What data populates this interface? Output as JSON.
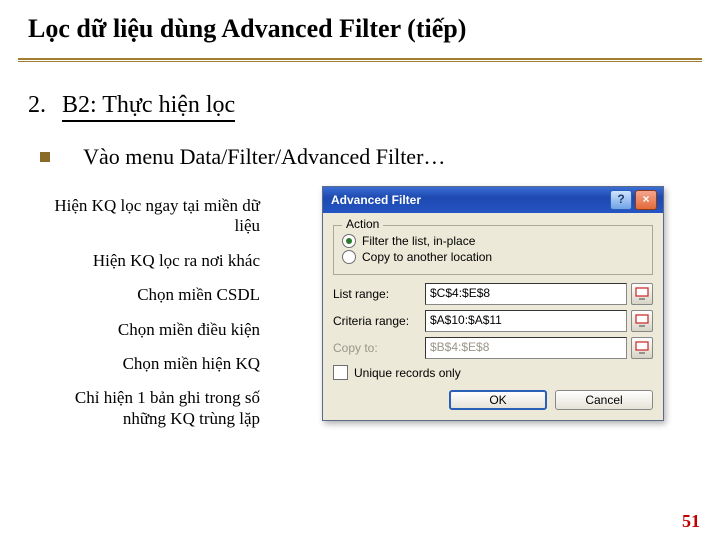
{
  "title": "Lọc dữ liệu dùng Advanced Filter (tiếp)",
  "step": {
    "num": "2.",
    "text": "B2: Thực hiện lọc"
  },
  "bullet": "Vào menu Data/Filter/Advanced Filter…",
  "annotations": {
    "a1": "Hiện KQ lọc ngay tại miền dữ liệu",
    "a2": "Hiện KQ lọc ra nơi khác",
    "a3": "Chọn miền CSDL",
    "a4": "Chọn miền điều kiện",
    "a5": "Chọn miền hiện KQ",
    "a6": "Chỉ hiện 1 bản ghi trong số những KQ trùng lặp"
  },
  "dialog": {
    "title": "Advanced Filter",
    "help": "?",
    "close": "×",
    "action_legend": "Action",
    "radio1": "Filter the list, in-place",
    "radio2": "Copy to another location",
    "list_range_lbl": "List range:",
    "list_range_val": "$C$4:$E$8",
    "criteria_lbl": "Criteria range:",
    "criteria_val": "$A$10:$A$11",
    "copyto_lbl": "Copy to:",
    "copyto_val": "$B$4:$E$8",
    "unique": "Unique records only",
    "ok": "OK",
    "cancel": "Cancel"
  },
  "page": "51"
}
